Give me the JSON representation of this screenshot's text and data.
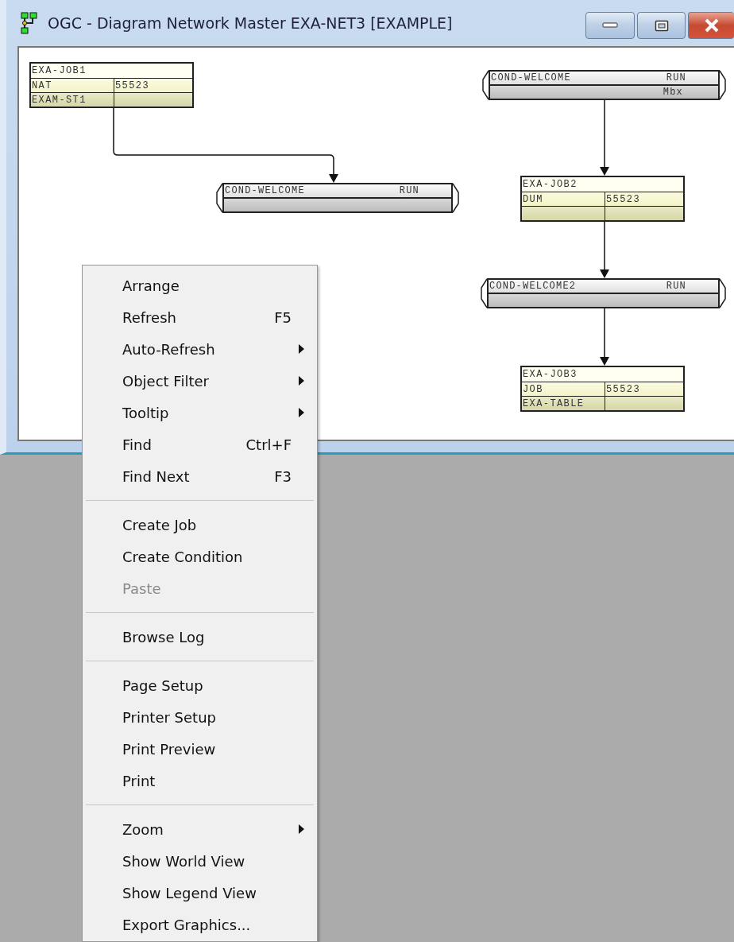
{
  "window": {
    "title": "OGC - Diagram Network Master EXA-NET3 [EXAMPLE]"
  },
  "diagram": {
    "nodes": [
      {
        "kind": "job",
        "name": "EXA-JOB1",
        "row_2": [
          "NAT",
          "55523"
        ],
        "row_3": [
          "EXAM-ST1"
        ]
      },
      {
        "kind": "condition",
        "name": "COND-WELCOME",
        "status": "RUN"
      },
      {
        "kind": "condition",
        "name": "COND-WELCOME",
        "status": "RUN",
        "detail": "Mbx"
      },
      {
        "kind": "job",
        "name": "EXA-JOB2",
        "row_2": [
          "DUM",
          "55523"
        ]
      },
      {
        "kind": "condition",
        "name": "COND-WELCOME2",
        "status": "RUN"
      },
      {
        "kind": "job",
        "name": "EXA-JOB3",
        "row_2": [
          "JOB",
          "55523"
        ],
        "row_3": [
          "EXA-TABLE"
        ]
      }
    ]
  },
  "context_menu": {
    "groups": [
      [
        {
          "label": "Arrange",
          "submenu": false,
          "disabled": false
        },
        {
          "label": "Refresh",
          "shortcut": "F5",
          "submenu": false,
          "disabled": false
        },
        {
          "label": "Auto-Refresh",
          "submenu": true,
          "disabled": false
        },
        {
          "label": "Object Filter",
          "submenu": true,
          "disabled": false
        },
        {
          "label": "Tooltip",
          "submenu": true,
          "disabled": false
        },
        {
          "label": "Find",
          "shortcut": "Ctrl+F",
          "submenu": false,
          "disabled": false
        },
        {
          "label": "Find Next",
          "shortcut": "F3",
          "submenu": false,
          "disabled": false
        }
      ],
      [
        {
          "label": "Create Job",
          "submenu": false,
          "disabled": false
        },
        {
          "label": "Create Condition",
          "submenu": false,
          "disabled": false
        },
        {
          "label": "Paste",
          "submenu": false,
          "disabled": true
        }
      ],
      [
        {
          "label": "Browse Log",
          "submenu": false,
          "disabled": false
        }
      ],
      [
        {
          "label": "Page Setup",
          "submenu": false,
          "disabled": false
        },
        {
          "label": "Printer Setup",
          "submenu": false,
          "disabled": false
        },
        {
          "label": "Print Preview",
          "submenu": false,
          "disabled": false
        },
        {
          "label": "Print",
          "submenu": false,
          "disabled": false
        }
      ],
      [
        {
          "label": "Zoom",
          "submenu": true,
          "disabled": false
        },
        {
          "label": "Show World View",
          "submenu": false,
          "disabled": false
        },
        {
          "label": "Show Legend View",
          "submenu": false,
          "disabled": false
        },
        {
          "label": "Export Graphics...",
          "submenu": false,
          "disabled": false
        }
      ]
    ]
  }
}
